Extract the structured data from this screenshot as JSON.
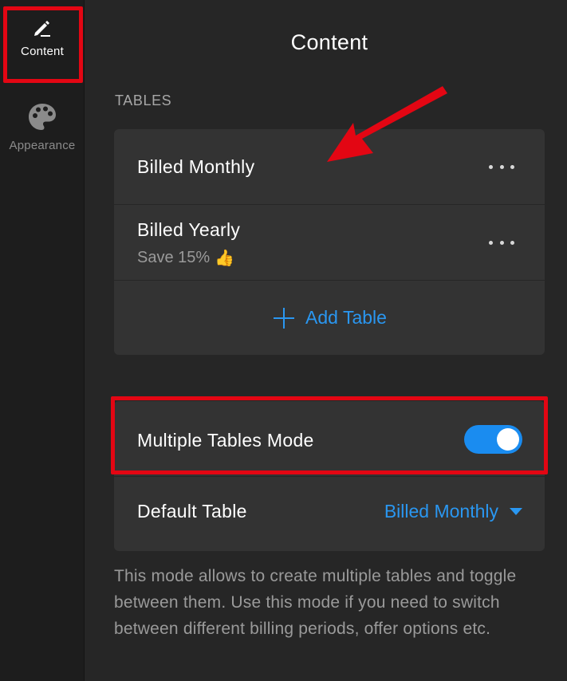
{
  "sidebar": {
    "items": [
      {
        "label": "Content",
        "icon": "pencil-icon",
        "active": true
      },
      {
        "label": "Appearance",
        "icon": "palette-icon",
        "active": false
      }
    ]
  },
  "header": {
    "title": "Content"
  },
  "tables_section": {
    "label": "TABLES",
    "items": [
      {
        "title": "Billed Monthly",
        "subtitle": ""
      },
      {
        "title": "Billed Yearly",
        "subtitle": "Save 15%",
        "emoji": "👍"
      }
    ],
    "add_label": "Add Table"
  },
  "mode": {
    "label": "Multiple Tables Mode",
    "enabled": true,
    "default_label": "Default Table",
    "default_value": "Billed Monthly",
    "help_text": "This mode allows to create multiple tables and toggle between them. Use this mode if you need to switch between different billing periods, offer options etc."
  },
  "colors": {
    "accent": "#2a97f1",
    "highlight": "#e30613",
    "background": "#262626",
    "card": "#333333"
  }
}
